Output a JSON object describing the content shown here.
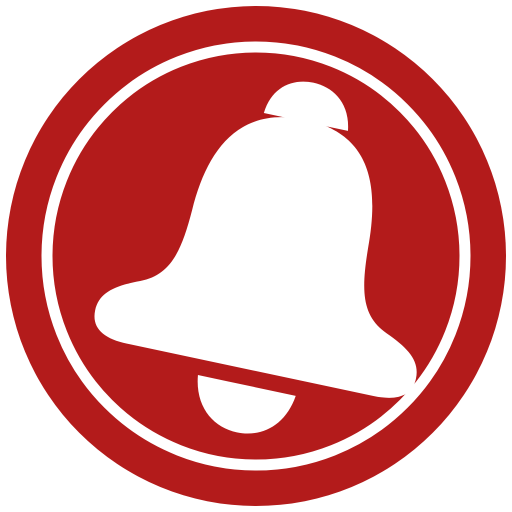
{
  "icon": {
    "name": "bell-icon",
    "colors": {
      "badge": "#b31b1b",
      "ring": "#ffffff",
      "bell": "#ffffff"
    }
  }
}
